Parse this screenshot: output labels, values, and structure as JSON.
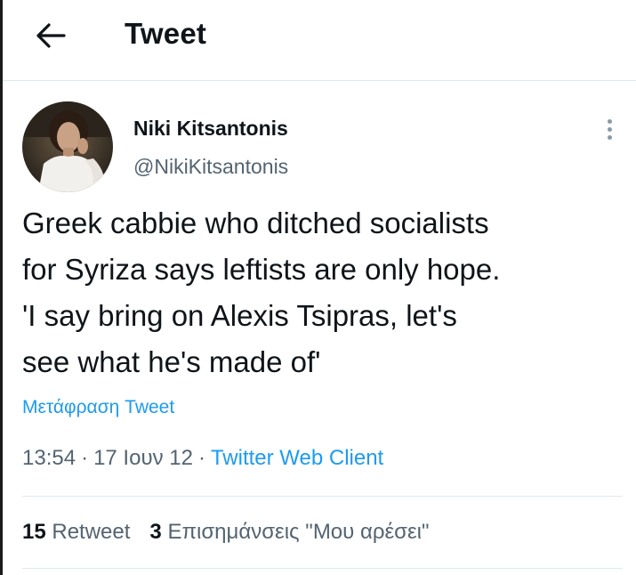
{
  "header": {
    "back_icon": "arrow-left-icon",
    "title": "Tweet"
  },
  "author": {
    "name": "Niki Kitsantonis",
    "handle": "@NikiKitsantonis",
    "avatar_icon": "profile-photo"
  },
  "tweet": {
    "text": "Greek cabbie who ditched socialists\nfor Syriza says leftists are only hope.\n'I say bring on Alexis Tsipras, let's\nsee what he's made of'",
    "translate_label": "Μετάφραση Tweet",
    "time": "13:54",
    "date": "17 Ιουν 12",
    "separator": "·",
    "client": "Twitter Web Client"
  },
  "stats": {
    "retweets_count": "15",
    "retweets_label": "Retweet",
    "likes_count": "3",
    "likes_label": "Επισημάνσεις \"Μου αρέσει\""
  },
  "colors": {
    "accent": "#1d9bf0",
    "text_primary": "#0f1419",
    "text_secondary": "#536471",
    "divider": "#e1e8ed"
  }
}
